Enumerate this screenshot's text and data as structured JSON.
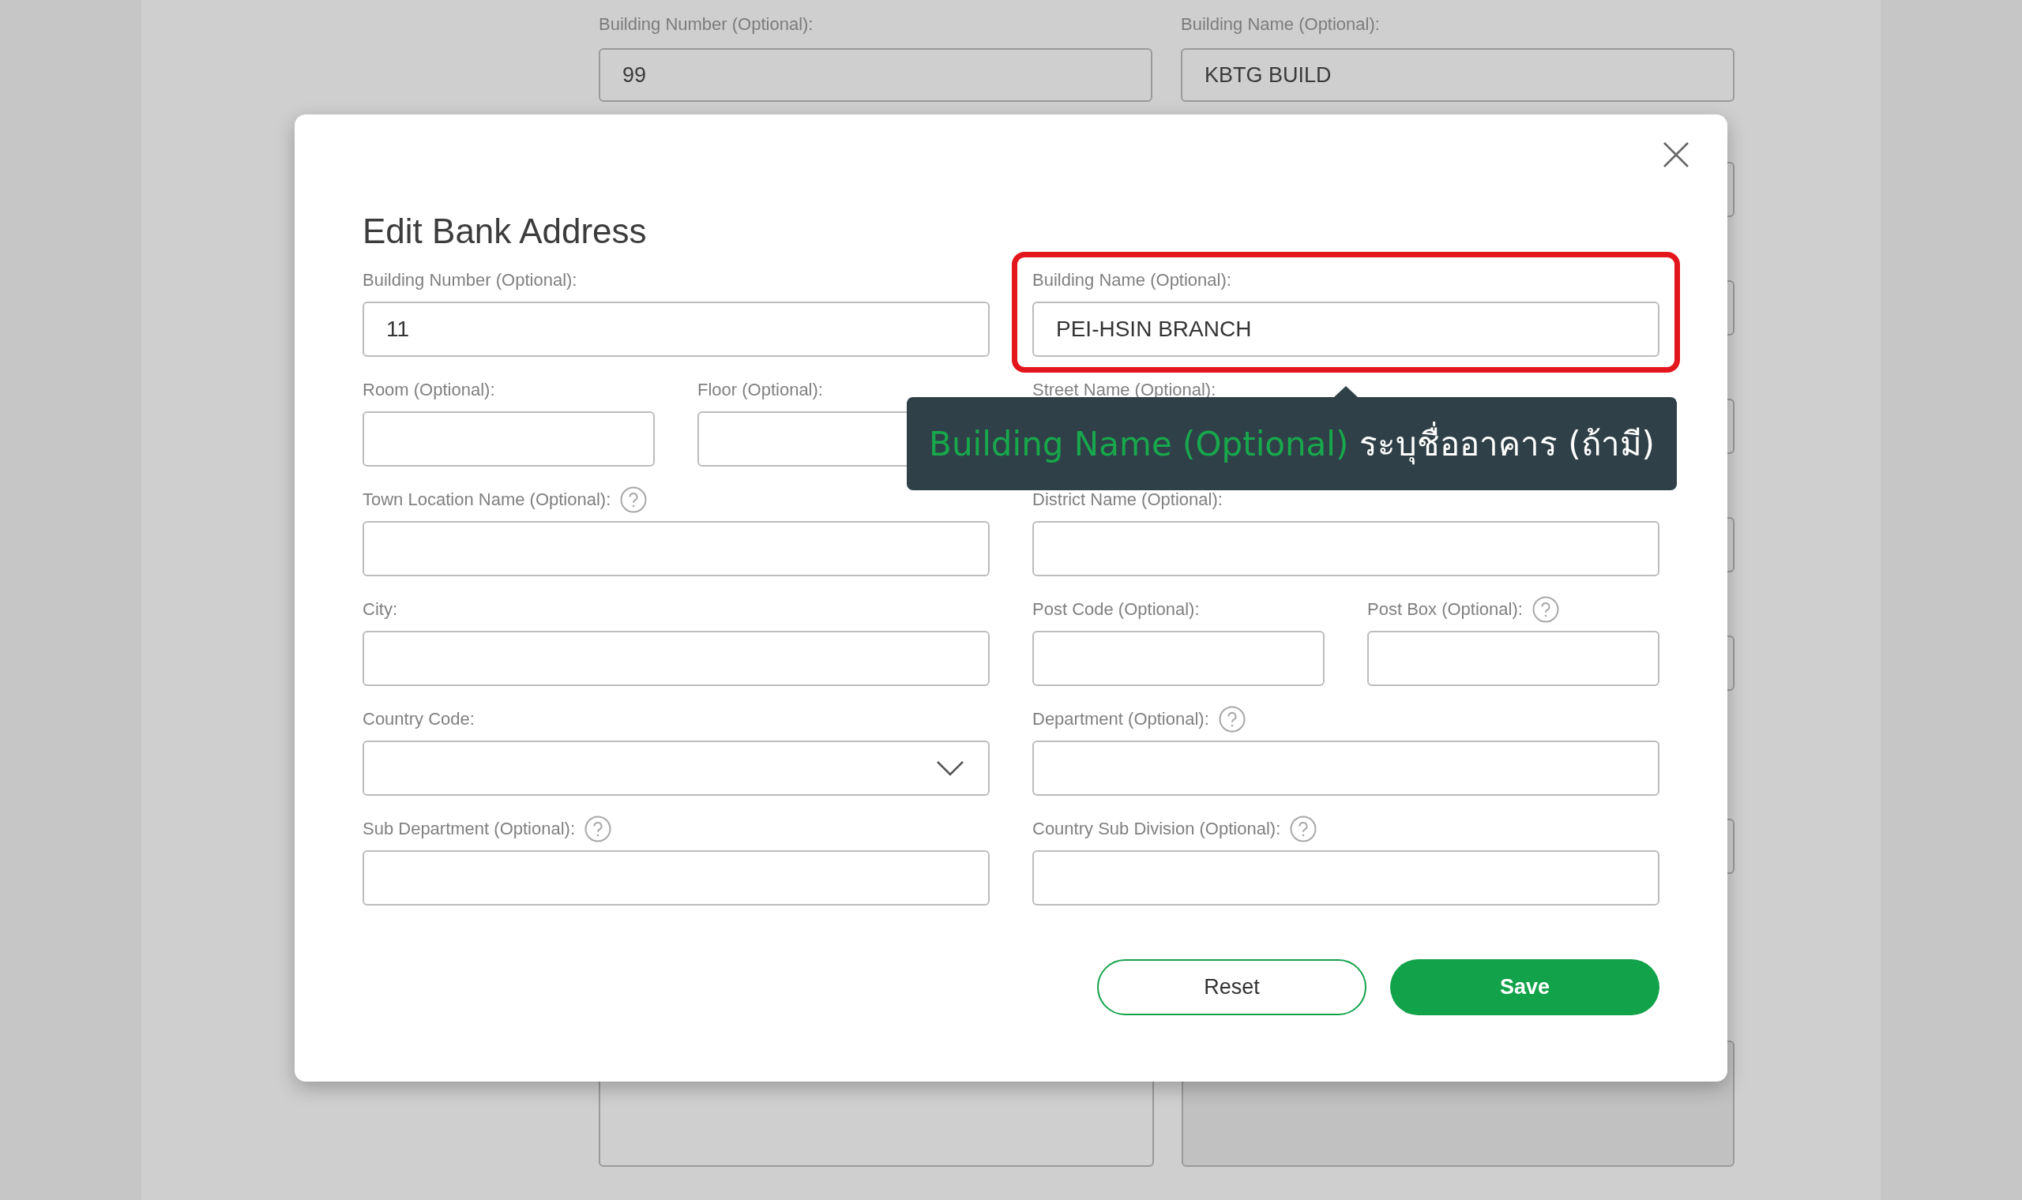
{
  "background_form": {
    "fields": [
      {
        "label": "Building Number (Optional):",
        "value": "99"
      },
      {
        "label": "Building Name (Optional):",
        "value": "KBTG BUILD"
      }
    ]
  },
  "dialog": {
    "title": "Edit Bank Address",
    "rows": [
      {
        "left": [
          {
            "label": "Building Number (Optional):",
            "kind": "text",
            "value": "11",
            "highlighted": false
          }
        ],
        "right": [
          {
            "label": "Building Name (Optional):",
            "kind": "text",
            "value": "PEI-HSIN BRANCH",
            "highlighted": true
          }
        ]
      },
      {
        "left": [
          {
            "label": "Room (Optional):",
            "kind": "text",
            "highlighted": false
          },
          {
            "label": "Floor (Optional):",
            "kind": "text",
            "highlighted": false
          }
        ],
        "right": [
          {
            "label": "Street Name (Optional):",
            "kind": "text",
            "highlighted": false
          }
        ]
      },
      {
        "left": [
          {
            "label": "Town Location Name (Optional):",
            "kind": "text_help",
            "highlighted": false
          }
        ],
        "right": [
          {
            "label": "District Name (Optional):",
            "kind": "text",
            "highlighted": false
          }
        ]
      },
      {
        "left": [
          {
            "label": "City:",
            "kind": "text",
            "highlighted": false
          }
        ],
        "right": [
          {
            "label": "Post Code (Optional):",
            "kind": "text",
            "highlighted": false
          },
          {
            "label": "Post Box (Optional):",
            "kind": "text_help",
            "highlighted": false
          }
        ]
      },
      {
        "left": [
          {
            "label": "Country Code:",
            "kind": "select",
            "highlighted": false
          }
        ],
        "right": [
          {
            "label": "Department (Optional):",
            "kind": "text_help",
            "highlighted": false
          }
        ]
      },
      {
        "left": [
          {
            "label": "Sub Department (Optional):",
            "kind": "text_help",
            "highlighted": false
          }
        ],
        "right": [
          {
            "label": "Country Sub Division (Optional):",
            "kind": "text_help",
            "highlighted": false
          }
        ]
      }
    ],
    "tooltip": {
      "term": "Building Name (Optional)",
      "text": "ระบุชื่ออาคาร (ถ้ามี)"
    },
    "buttons": [
      {
        "label": "Reset",
        "kind": "secondary"
      },
      {
        "label": "Save",
        "kind": "primary"
      }
    ]
  }
}
